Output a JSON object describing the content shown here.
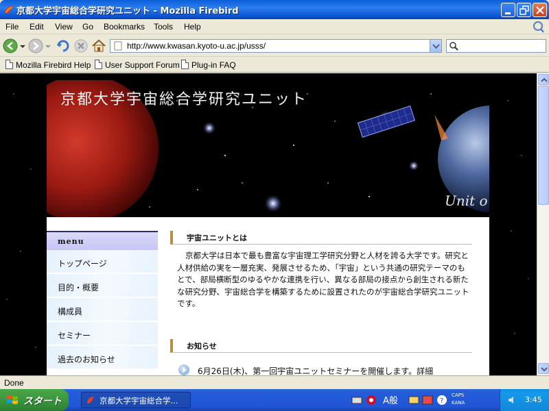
{
  "window": {
    "title": "京都大学宇宙総合学研究ユニット - Mozilla Firebird"
  },
  "menubar": {
    "items": [
      "File",
      "Edit",
      "View",
      "Go",
      "Bookmarks",
      "Tools",
      "Help"
    ]
  },
  "toolbar": {
    "url": "http://www.kwasan.kyoto-u.ac.jp/usss/",
    "search_value": ""
  },
  "bookmarks": {
    "items": [
      "Mozilla Firebird Help",
      "User Support Forum",
      "Plug-in FAQ"
    ]
  },
  "page": {
    "banner_title": "京都大学宇宙総合学研究ユニット",
    "banner_subtitle": "Unit o",
    "menu_heading": "menu",
    "menu_items": [
      "トップページ",
      "目的・概要",
      "構成員",
      "セミナー",
      "過去のお知らせ"
    ],
    "about_heading": "宇宙ユニットとは",
    "about_text": "京都大学は日本で最も豊富な宇宙理工学研究分野と人材を誇る大学です。研究と人材供給の実を一層充実、発展させるため、「宇宙」という共通の研究テーマのもとで、部局横断型のゆるやかな連携を行い、異なる部局の接点から創生される新たな研究分野、宇宙総合学を構築するために設置されたのが宇宙総合学研究ユニットです。",
    "news_heading": "お知らせ",
    "news_items": [
      "6月26日(木)、第一回宇宙ユニットセミナーを開催します。詳細"
    ]
  },
  "status": {
    "text": "Done"
  },
  "taskbar": {
    "start_label": "スタート",
    "task_label": "京都大学宇宙総合学...",
    "ime_mode": "A般",
    "caps": "CAPS",
    "kana": "KANA",
    "clock": "3:45"
  },
  "colors": {
    "titlebar": "#0b54d2",
    "menu_heading_bg": "#c8c5f4",
    "section_accent": "#b8903a",
    "taskbar": "#245edb",
    "start_button": "#36933a"
  }
}
